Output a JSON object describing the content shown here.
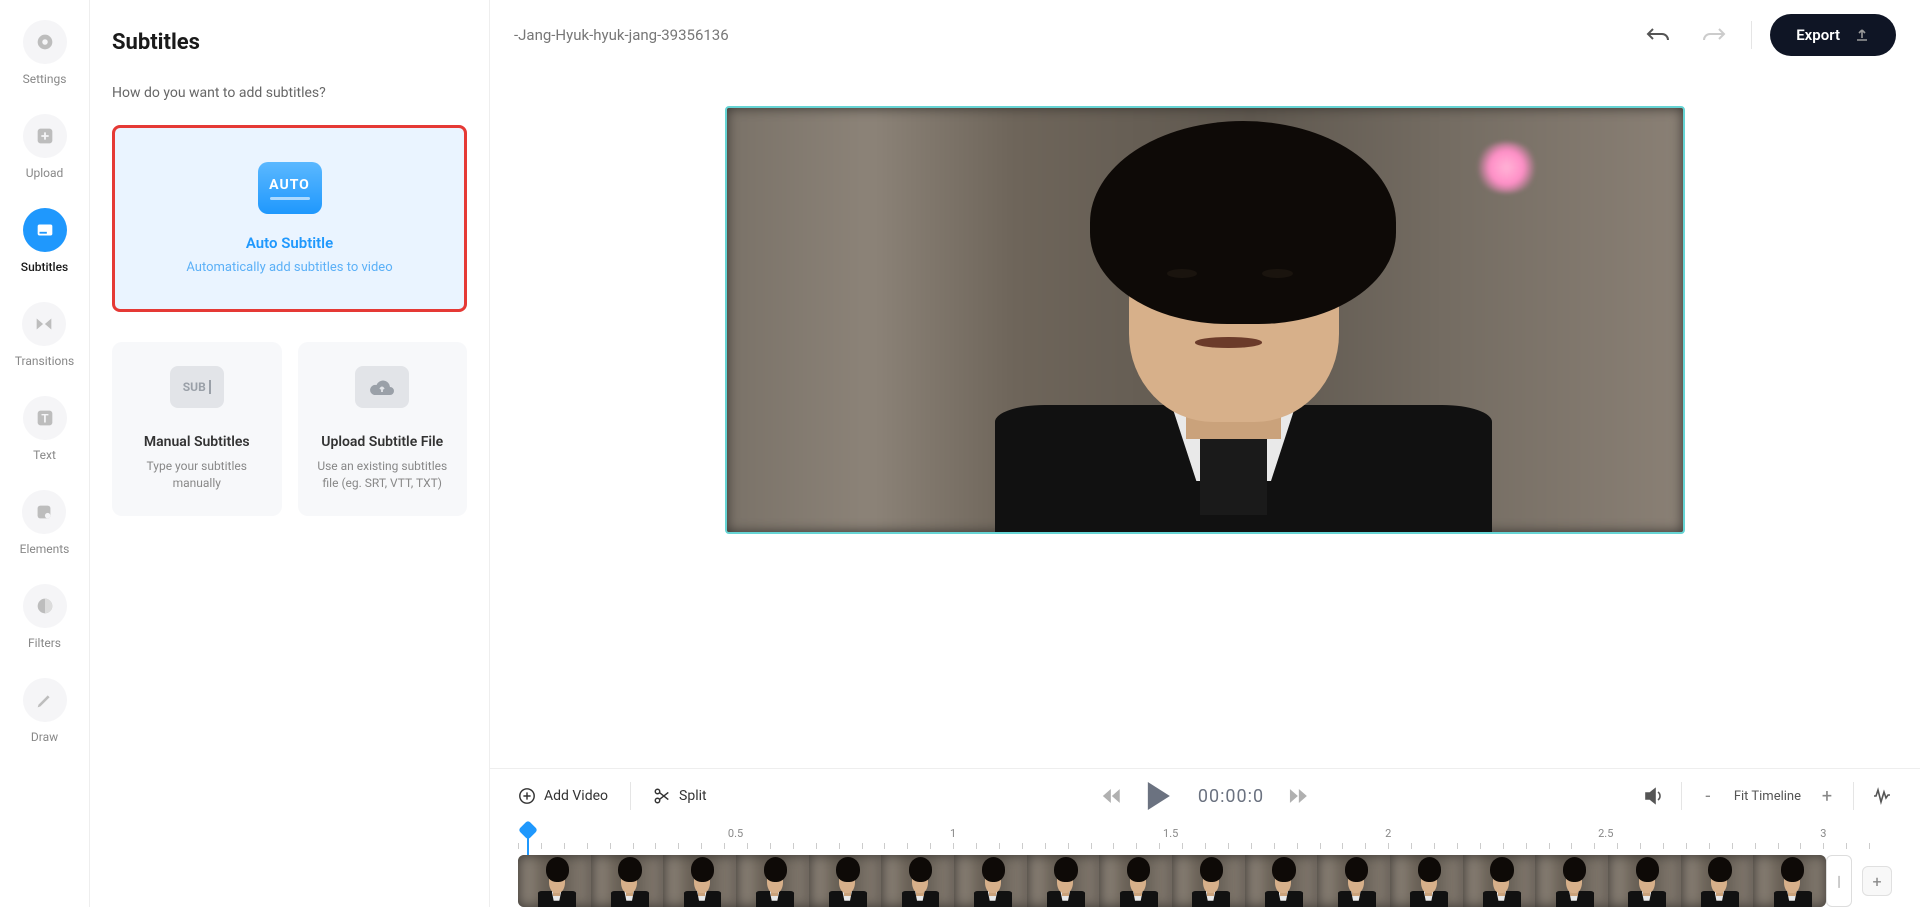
{
  "nav": [
    {
      "id": "settings",
      "label": "Settings"
    },
    {
      "id": "upload",
      "label": "Upload"
    },
    {
      "id": "subtitles",
      "label": "Subtitles"
    },
    {
      "id": "transitions",
      "label": "Transitions"
    },
    {
      "id": "text",
      "label": "Text"
    },
    {
      "id": "elements",
      "label": "Elements"
    },
    {
      "id": "filters",
      "label": "Filters"
    },
    {
      "id": "draw",
      "label": "Draw"
    }
  ],
  "active_nav": "subtitles",
  "panel": {
    "title": "Subtitles",
    "subtitle": "How do you want to add subtitles?",
    "auto": {
      "badge": "AUTO",
      "title": "Auto Subtitle",
      "desc": "Automatically add subtitles to video"
    },
    "manual": {
      "icon": "SUB",
      "title": "Manual Subtitles",
      "desc": "Type your subtitles manually"
    },
    "upload": {
      "title": "Upload Subtitle File",
      "desc": "Use an existing subtitles file (eg. SRT, VTT, TXT)"
    }
  },
  "project_title": "-Jang-Hyuk-hyuk-jang-39356136",
  "export_label": "Export",
  "toolbar": {
    "add_video": "Add Video",
    "split": "Split",
    "timecode": "00:00:0",
    "fit": "Fit Timeline",
    "minus": "-",
    "plus": "+"
  },
  "ruler_marks": [
    "0.5",
    "1",
    "1.5",
    "2",
    "2.5",
    "3"
  ],
  "thumb_count": 18
}
